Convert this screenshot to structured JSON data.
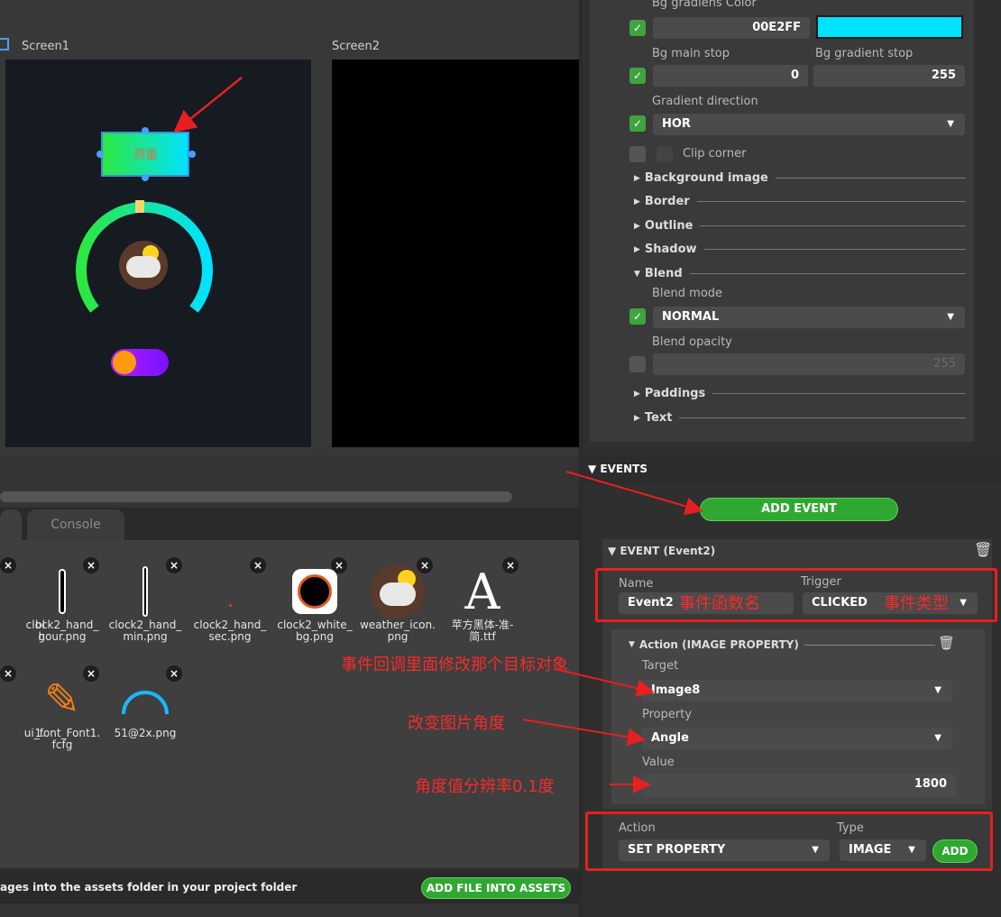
{
  "screens": {
    "screen1_label": "Screen1",
    "screen2_label": "Screen2"
  },
  "screen1": {
    "button_label": "测量"
  },
  "tabs": {
    "console_label": "Console"
  },
  "assets": [
    {
      "name": "bl\ng"
    },
    {
      "name": "clock2_hand_\nhour.png"
    },
    {
      "name": "clock2_hand_\nmin.png"
    },
    {
      "name": "clock2_hand_\nsec.png"
    },
    {
      "name": "clock2_white_\nbg.png"
    },
    {
      "name": "weather_icon.\npng"
    },
    {
      "name": "苹方黑体-准-\n简.ttf"
    },
    {
      "name": "1."
    },
    {
      "name": "ui_font_Font1.\nfcfg"
    },
    {
      "name": "51@2x.png"
    }
  ],
  "bottom": {
    "hint": "ages into the assets folder in your project folder",
    "add_file_label": "ADD FILE INTO ASSETS"
  },
  "style": {
    "bg_grad_color_label": "Bg gradiens Color",
    "bg_grad_color_value": "00E2FF",
    "bg_grad_swatch": "#00E2FF",
    "bg_main_stop_label": "Bg main stop",
    "bg_main_stop_value": "0",
    "bg_grad_stop_label": "Bg gradient stop",
    "bg_grad_stop_value": "255",
    "grad_dir_label": "Gradient direction",
    "grad_dir_value": "HOR",
    "clip_corner_label": "Clip corner",
    "sections": [
      "Background image",
      "Border",
      "Outline",
      "Shadow",
      "Blend",
      "Paddings",
      "Text"
    ],
    "blend_mode_label": "Blend mode",
    "blend_mode_value": "NORMAL",
    "blend_opacity_label": "Blend opacity",
    "blend_opacity_value": "255"
  },
  "events": {
    "header": "EVENTS",
    "add_event_label": "ADD EVENT",
    "event_title": "EVENT (Event2)",
    "name_label": "Name",
    "name_value": "Event2",
    "trigger_label": "Trigger",
    "trigger_value": "CLICKED",
    "action_title": "Action (IMAGE PROPERTY)",
    "target_label": "Target",
    "target_value": "Image8",
    "property_label": "Property",
    "property_value": "Angle",
    "value_label": "Value",
    "value_value": "1800",
    "action_label": "Action",
    "action_value": "SET PROPERTY",
    "type_label": "Type",
    "type_value": "IMAGE",
    "add_label": "ADD"
  },
  "annotations": {
    "name_note": "事件函数名",
    "trigger_note": "事件类型",
    "target_note": "事件回调里面修改那个目标对象",
    "angle_note": "改变图片角度",
    "resolution_note": "角度值分辨率0.1度"
  },
  "colors": {
    "accent_green": "#2fa831",
    "annotation_red": "#e62020",
    "gradient_cyan": "#00E2FF"
  }
}
